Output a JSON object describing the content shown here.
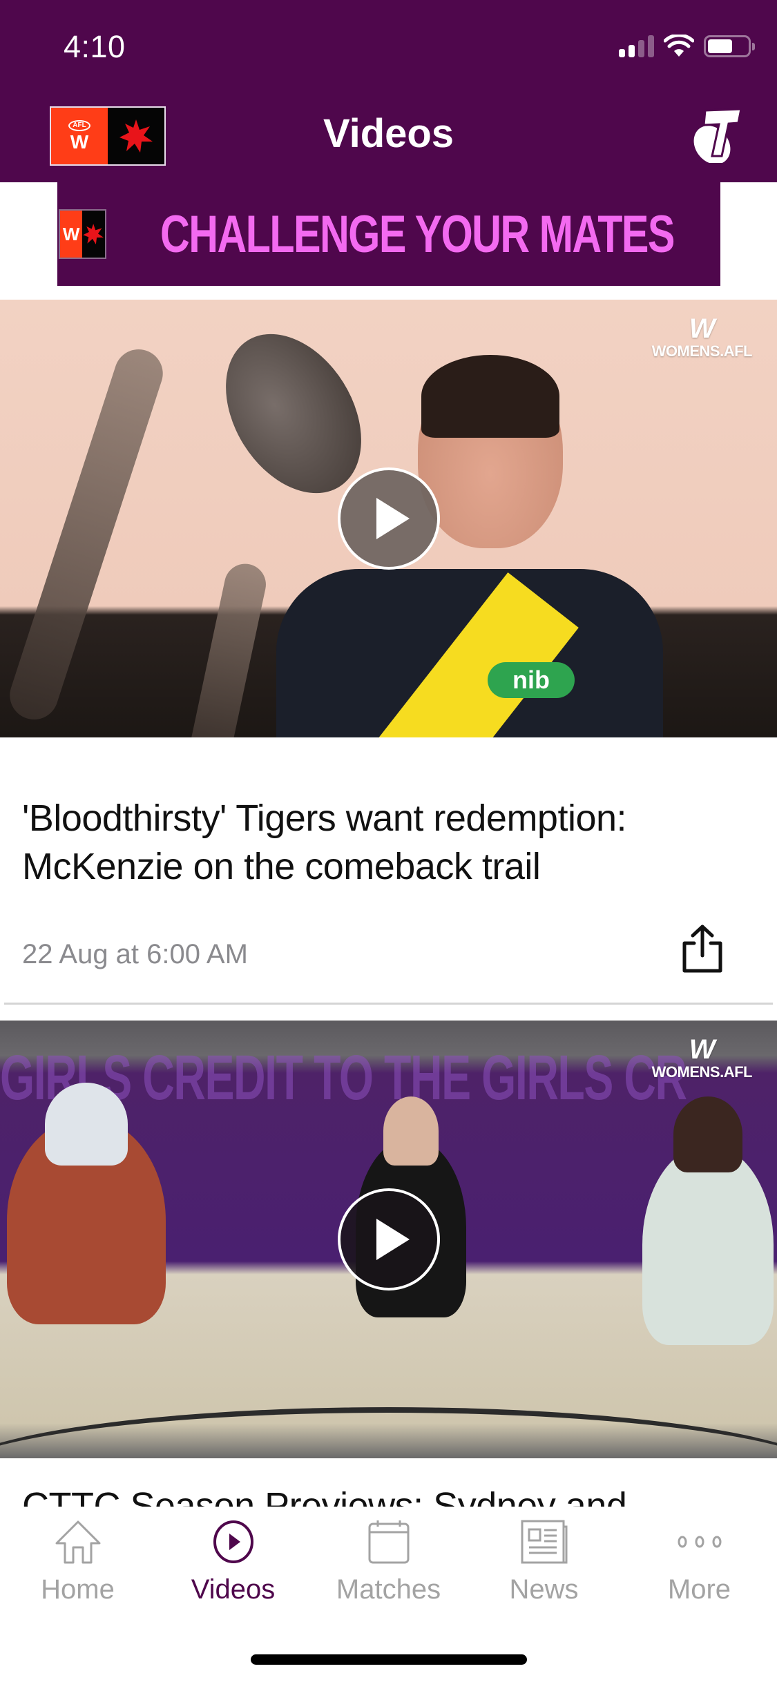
{
  "status_bar": {
    "time": "4:10",
    "signal_bars_active": 2,
    "signal_bars_total": 4,
    "battery_level_percent": 62
  },
  "header": {
    "title": "Videos",
    "left_logo": "aflw-nab-logo",
    "left_logo_text": "AFL",
    "right_logo": "telstra-logo"
  },
  "banner": {
    "text": "CHALLENGE YOUR MATES",
    "logo": "aflw-nab-logo",
    "text_color": "#f36af0",
    "background_color": "#4f074c"
  },
  "videos": [
    {
      "title": "'Bloodthirsty' Tigers want redemption: McKenzie on the comeback trail",
      "date": "22 Aug at 6:00 AM",
      "watermark": "WOMENS.AFL",
      "sponsor_text": "nib",
      "play_icon": "play-icon",
      "share_icon": "share-icon"
    },
    {
      "title": "CTTC Season Previews: Sydney and",
      "watermark": "WOMENS.AFL",
      "backdrop_text": "GIRLS  CREDIT  TO THE  GIRLS  CR",
      "play_icon": "play-icon"
    }
  ],
  "tab_bar": {
    "active": "Videos",
    "active_color": "#4f074c",
    "inactive_color": "#a3a3a3",
    "tabs": [
      {
        "label": "Home",
        "icon": "home-icon"
      },
      {
        "label": "Videos",
        "icon": "play-circle-icon"
      },
      {
        "label": "Matches",
        "icon": "calendar-icon"
      },
      {
        "label": "News",
        "icon": "newspaper-icon"
      },
      {
        "label": "More",
        "icon": "more-dots-icon"
      }
    ]
  },
  "theme": {
    "brand_purple": "#4f074c",
    "aflw_orange": "#ff3d17",
    "nab_red": "#e8141a"
  }
}
